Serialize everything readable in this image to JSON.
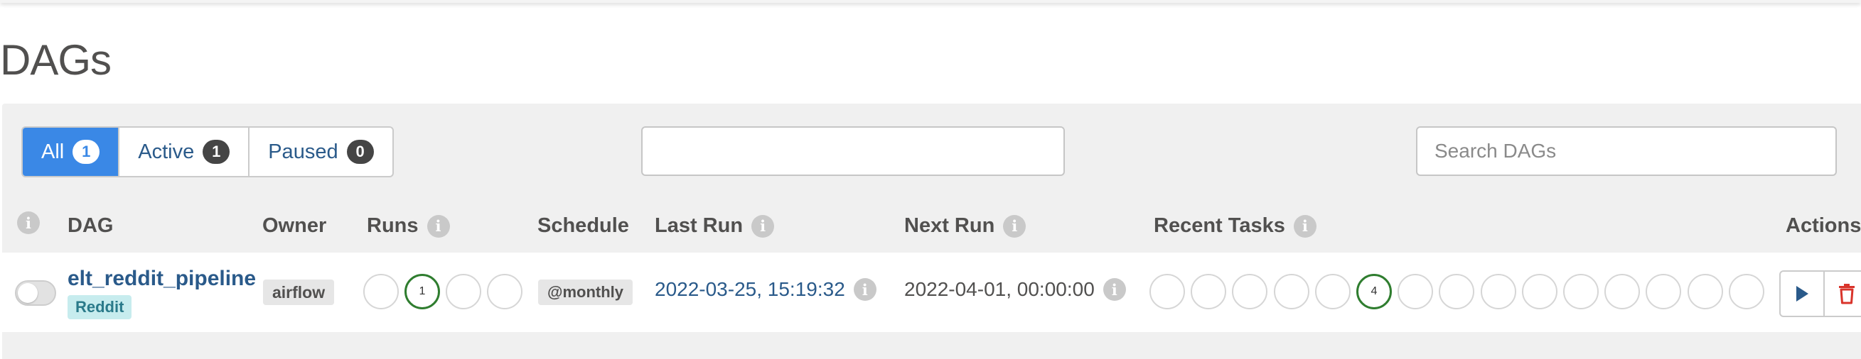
{
  "page": {
    "title": "DAGs"
  },
  "filters": [
    {
      "label": "All",
      "count": "1"
    },
    {
      "label": "Active",
      "count": "1"
    },
    {
      "label": "Paused",
      "count": "0"
    }
  ],
  "search": {
    "placeholder": "Search DAGs"
  },
  "table": {
    "headers": {
      "dag": "DAG",
      "owner": "Owner",
      "runs": "Runs",
      "schedule": "Schedule",
      "last_run": "Last Run",
      "next_run": "Next Run",
      "recent_tasks": "Recent Tasks",
      "actions": "Actions"
    },
    "rows": [
      {
        "dag_id": "elt_reddit_pipeline",
        "tag": "Reddit",
        "owner": "airflow",
        "runs": [
          "",
          "1",
          "",
          ""
        ],
        "schedule": "@monthly",
        "last_run": "2022-03-25, 15:19:32",
        "next_run": "2022-04-01, 00:00:00",
        "recent_tasks": [
          "",
          "",
          "",
          "",
          "",
          "4",
          "",
          "",
          "",
          "",
          "",
          "",
          "",
          "",
          ""
        ]
      }
    ]
  },
  "colors": {
    "accent": "#3a88e6",
    "link": "#2a5a8a",
    "success": "#2f7d2f",
    "delete": "#d9342b",
    "tag_bg": "#c7ecee"
  },
  "icons": {
    "info": "info-icon",
    "trigger": "play-icon",
    "delete": "trash-icon"
  }
}
